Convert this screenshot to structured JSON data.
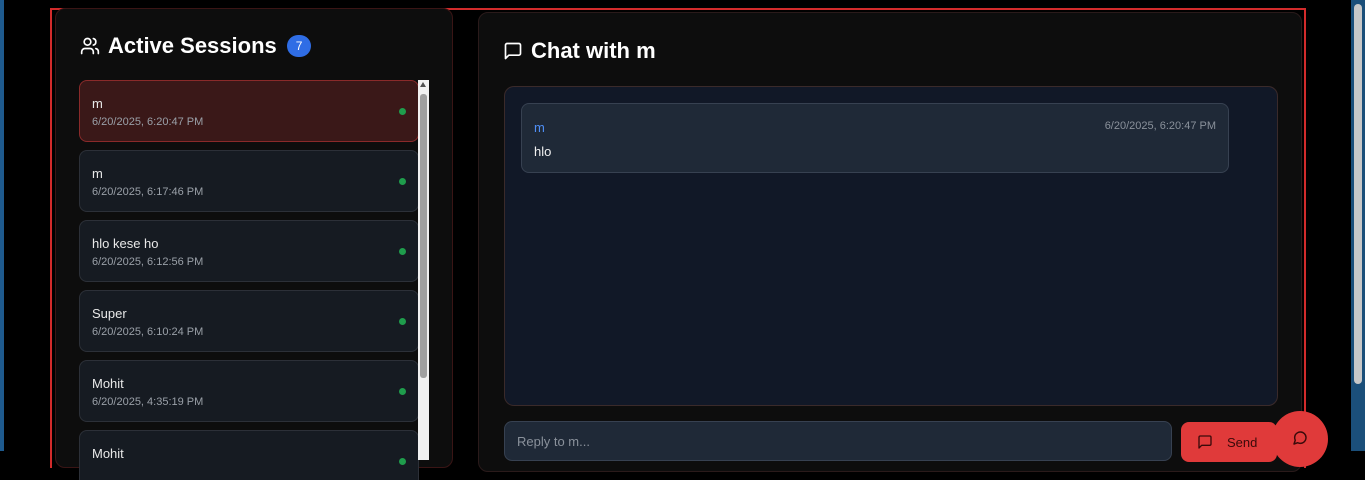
{
  "sessions": {
    "title": "Active Sessions",
    "count": "7",
    "items": [
      {
        "name": "m",
        "time": "6/20/2025, 6:20:47 PM",
        "active": true
      },
      {
        "name": "m",
        "time": "6/20/2025, 6:17:46 PM",
        "active": false
      },
      {
        "name": "hlo kese ho",
        "time": "6/20/2025, 6:12:56 PM",
        "active": false
      },
      {
        "name": "Super",
        "time": "6/20/2025, 6:10:24 PM",
        "active": false
      },
      {
        "name": "Mohit",
        "time": "6/20/2025, 4:35:19 PM",
        "active": false
      },
      {
        "name": "Mohit",
        "time": "",
        "active": false
      }
    ]
  },
  "chat": {
    "title": "Chat with m",
    "messages": [
      {
        "sender": "m",
        "time": "6/20/2025, 6:20:47 PM",
        "text": "hlo"
      }
    ],
    "reply_placeholder": "Reply to m...",
    "send_label": "Send"
  },
  "icons": {
    "sessions": "users-icon",
    "chat": "message-square-icon",
    "send": "message-square-icon",
    "fab": "message-circle-icon"
  },
  "colors": {
    "accent_red": "#e03a3a",
    "badge_blue": "#2f6de5",
    "online_green": "#1f9d4c",
    "sender_blue": "#4f8ff7"
  }
}
